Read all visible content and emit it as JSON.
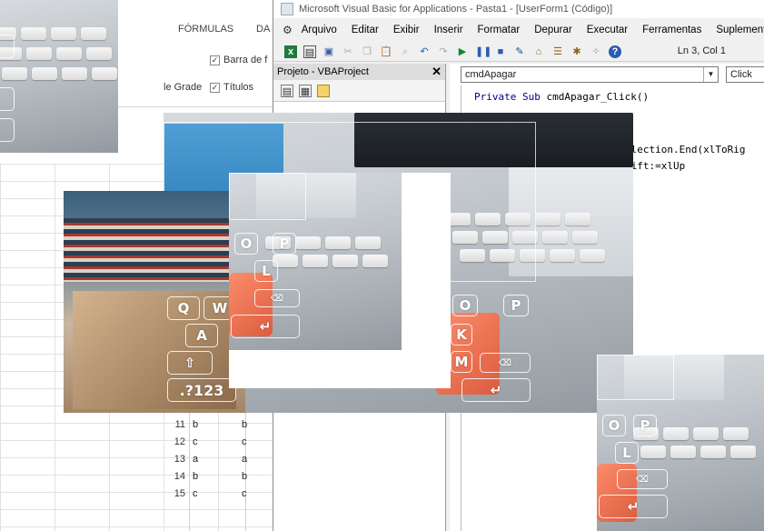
{
  "excel": {
    "ribbon_tabs": [
      "FÓRMULAS",
      "DA"
    ],
    "checkboxes": [
      {
        "label": "Barra de f",
        "checked": true
      },
      {
        "label": "Títulos",
        "checked": true
      }
    ],
    "grid_label": "le Grade",
    "rows": [
      {
        "num": "11",
        "a": "b",
        "b": "b"
      },
      {
        "num": "12",
        "a": "c",
        "b": "c"
      },
      {
        "num": "13",
        "a": "a",
        "b": "a"
      },
      {
        "num": "14",
        "a": "b",
        "b": "b"
      },
      {
        "num": "15",
        "a": "c",
        "b": "c"
      }
    ]
  },
  "vba": {
    "title": "Microsoft Visual Basic for Applications - Pasta1 - [UserForm1 (Código)]",
    "menu": [
      "Arquivo",
      "Editar",
      "Exibir",
      "Inserir",
      "Formatar",
      "Depurar",
      "Executar",
      "Ferramentas",
      "Suplementos"
    ],
    "cursor_pos": "Ln 3, Col 1",
    "project_title": "Projeto - VBAProject",
    "object_select": "cmdApagar",
    "proc_select": "Click",
    "code": {
      "line1_kw": "Private Sub",
      "line1_rest": " cmdApagar_Click()",
      "line3": "election.End(xlToRig",
      "line4": "hift:=xlUp"
    }
  },
  "collage": {
    "keys": [
      "Q",
      "W",
      "A",
      "O",
      "P",
      "L",
      "K",
      "M",
      ".?123"
    ],
    "shift_icon": "shift-arrow-icon",
    "return_icon": "return-arrow-icon",
    "backspace_icon": "backspace-icon",
    "colors": {
      "accent_red": "#e8603f",
      "desk_blue": "#2e7fb8"
    }
  }
}
